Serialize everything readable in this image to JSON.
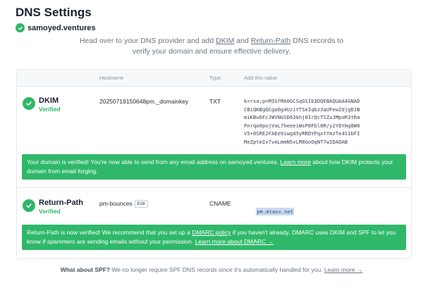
{
  "header": {
    "title": "DNS Settings",
    "domain": "samoyed.ventures"
  },
  "intro": {
    "part1": "Head over to your DNS provider and add ",
    "dkim_link": "DKIM",
    "and": " and ",
    "returnpath_link": "Return-Path",
    "part2": " DNS records to",
    "line2": "verify your domain and ensure effective delivery."
  },
  "table": {
    "headers": {
      "hostname": "Hostname",
      "type": "Type",
      "value": "Add this value"
    }
  },
  "records": {
    "dkim": {
      "name": "DKIM",
      "status": "Verified",
      "hostname": "20250719150648pm._domainkey",
      "type": "TXT",
      "value": "k=rsa;p=MIGfMA0GCSqGSIb3DQEBAQUAA4GNAD\nCBiQKBgQCga0g4UziYTSeIqbz3qUFewZdjgDJB\nmiKBu6FcJWVNGSD63khj0IrQcTSZzJMpoR3tRa\nPnrqo0pojVaL7heeeiWsP8Fbl0R/y2YDYmg8W0\nV5+0SRE2FAEe9iwgd5yRRDYPqxtYmzTe4S1bFI\nMeZptmIv7vALmmN5vLM8GoOqNT7wIDAQAB"
    },
    "returnpath": {
      "name": "Return-Path",
      "status": "Verified",
      "hostname": "pm-bounces",
      "edit_label": "Edit",
      "type": "CNAME",
      "value": "pm.mtasv.net"
    }
  },
  "banners": {
    "dkim": {
      "text1": "Your domain is verified! You're now able to send from any email address on samoyed.ventures. ",
      "link": "Learn more",
      "text2": " about how DKIM protects your",
      "line2": "domain from email forging."
    },
    "returnpath": {
      "text1": "Return-Path is now verified! We recommend that you set up a ",
      "link1": "DMARC policy",
      "text2": " if you haven't already. DMARC uses DKIM and SPF to let you",
      "line2": "know if spammers are sending emails without your permission. ",
      "link2": "Learn more about DMARC →"
    }
  },
  "footer": {
    "bold": "What about SPF?",
    "text": " We no longer require SPF DNS records since it's automatically handled for you. ",
    "link": "Learn more →"
  },
  "colors": {
    "accent": "#2fb86a",
    "title": "#1b2230",
    "muted": "#6b7482"
  }
}
